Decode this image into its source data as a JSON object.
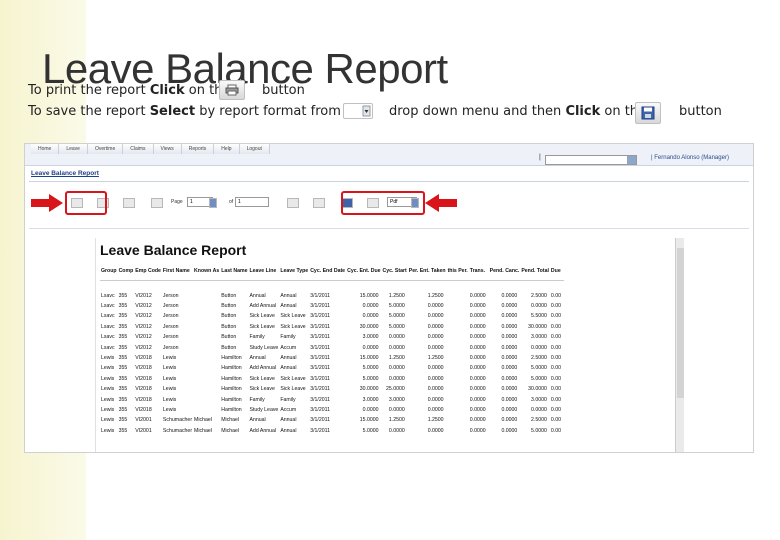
{
  "slide": {
    "title": "Leave Balance Report",
    "line1": {
      "before": "To print the report ",
      "bold": "Click",
      "after": " on the",
      "after_button": "button"
    },
    "line2": {
      "before": "To save the report ",
      "bold": "Select",
      "mid": " by report format from the",
      "mid2": "drop down menu and then ",
      "bold2": "Click",
      "end": " on the",
      "after_button": "button"
    }
  },
  "app": {
    "menu": [
      "Home",
      "Leave",
      "Overtime",
      "Claims",
      "Views",
      "Reports",
      "Help",
      "Logout"
    ],
    "pipe": "|",
    "user": "| Fernando Alonso (Manager)",
    "report_link": "Leave Balance Report",
    "toolbar": {
      "page_label": "Page",
      "page_value": "1",
      "of_label": "of",
      "of_value": "1",
      "format_value": "Pdf"
    }
  },
  "report": {
    "heading": "Leave Balance Report",
    "columns": [
      "Group",
      "Comp",
      "Emp Code",
      "First Name",
      "Known As",
      "Last Name",
      "Leave Line",
      "Leave Type",
      "Cyc. End Date",
      "Cyc. Ent. Due",
      "Cyc. Start",
      "Per. Ent. Taken",
      "this Per.",
      "Trans.",
      "Pend. Canc.",
      "Pend. Total",
      "Due",
      "PL"
    ],
    "rows": [
      [
        "Lsavc",
        "355",
        "VI2012",
        "Jerson",
        "",
        "Button",
        "Annual",
        "Annual",
        "3/1/2011",
        "15.0000",
        "1.2500",
        "1.2500",
        "",
        "0.0000",
        "0.0000",
        "2.5000",
        "0.00"
      ],
      [
        "Lsavc",
        "355",
        "VI2012",
        "Jerson",
        "",
        "Button",
        "Add Annual",
        "Annual",
        "3/1/2011",
        "0.0000",
        "5.0000",
        "0.0000",
        "",
        "0.0000",
        "0.0000",
        "0.0000",
        "0.00"
      ],
      [
        "Lsavc",
        "355",
        "VI2012",
        "Jerson",
        "",
        "Button",
        "Sick Leave",
        "Sick Leave",
        "3/1/2011",
        "0.0000",
        "5.0000",
        "0.0000",
        "",
        "0.0000",
        "0.0000",
        "5.5000",
        "0.00"
      ],
      [
        "Lsavc",
        "355",
        "VI2012",
        "Jerson",
        "",
        "Button",
        "Sick Leave",
        "Sick Leave",
        "3/1/2011",
        "30.0000",
        "5.0000",
        "0.0000",
        "",
        "0.0000",
        "0.0000",
        "30.0000",
        "0.00"
      ],
      [
        "Lsavc",
        "355",
        "VI2012",
        "Jerson",
        "",
        "Button",
        "Family",
        "Family",
        "3/1/2011",
        "3.0000",
        "0.0000",
        "0.0000",
        "",
        "0.0000",
        "0.0000",
        "3.0000",
        "0.00"
      ],
      [
        "Lsavc",
        "355",
        "VI2012",
        "Jerson",
        "",
        "Button",
        "Study Leave",
        "Accum",
        "3/1/2011",
        "0.0000",
        "0.0000",
        "0.0000",
        "",
        "0.0000",
        "0.0000",
        "0.0000",
        "0.00"
      ],
      [
        "Lewis",
        "355",
        "VI2018",
        "Lewis",
        "",
        "Hamilton",
        "Annual",
        "Annual",
        "3/1/2011",
        "15.0000",
        "1.2500",
        "1.2500",
        "",
        "0.0000",
        "0.0000",
        "2.5000",
        "0.00"
      ],
      [
        "Lewis",
        "355",
        "VI2018",
        "Lewis",
        "",
        "Hamilton",
        "Add Annual",
        "Annual",
        "3/1/2011",
        "5.0000",
        "0.0000",
        "0.0000",
        "",
        "0.0000",
        "0.0000",
        "5.0000",
        "0.00"
      ],
      [
        "Lewis",
        "355",
        "VI2018",
        "Lewis",
        "",
        "Hamilton",
        "Sick Leave",
        "Sick Leave",
        "3/1/2011",
        "5.0000",
        "0.0000",
        "0.0000",
        "",
        "0.0000",
        "0.0000",
        "5.0000",
        "0.00"
      ],
      [
        "Lewis",
        "355",
        "VI2018",
        "Lewis",
        "",
        "Hamilton",
        "Sick Leave",
        "Sick Leave",
        "3/1/2011",
        "30.0000",
        "25.0000",
        "0.0000",
        "",
        "0.0000",
        "0.0000",
        "30.0000",
        "0.00"
      ],
      [
        "Lewis",
        "355",
        "VI2018",
        "Lewis",
        "",
        "Hamilton",
        "Family",
        "Family",
        "3/1/2011",
        "3.0000",
        "3.0000",
        "0.0000",
        "",
        "0.0000",
        "0.0000",
        "3.0000",
        "0.00"
      ],
      [
        "Lewis",
        "355",
        "VI2018",
        "Lewis",
        "",
        "Hamilton",
        "Study Leave",
        "Accum",
        "3/1/2011",
        "0.0000",
        "0.0000",
        "0.0000",
        "",
        "0.0000",
        "0.0000",
        "0.0000",
        "0.00"
      ],
      [
        "Lewis",
        "355",
        "VI2001",
        "Schumacher",
        "Michael",
        "Michael",
        "Annual",
        "Annual",
        "3/1/2011",
        "15.0000",
        "1.2500",
        "1.2500",
        "",
        "0.0000",
        "0.0000",
        "2.5000",
        "0.00"
      ],
      [
        "Lewis",
        "355",
        "VI2001",
        "Schumacher",
        "Michael",
        "Michael",
        "Add Annual",
        "Annual",
        "3/1/2011",
        "5.0000",
        "0.0000",
        "0.0000",
        "",
        "0.0000",
        "0.0000",
        "5.0000",
        "0.00"
      ]
    ]
  },
  "colors": {
    "red_highlight": "#d9141b",
    "left_bar": "#f6f4cf",
    "link_blue": "#1f3f86"
  },
  "icons": [
    "print-icon",
    "export-icon",
    "save-icon",
    "first-page-icon",
    "prev-page-icon",
    "next-page-icon",
    "last-page-icon",
    "dropdown-arrow-icon",
    "red-arrow-icon"
  ]
}
